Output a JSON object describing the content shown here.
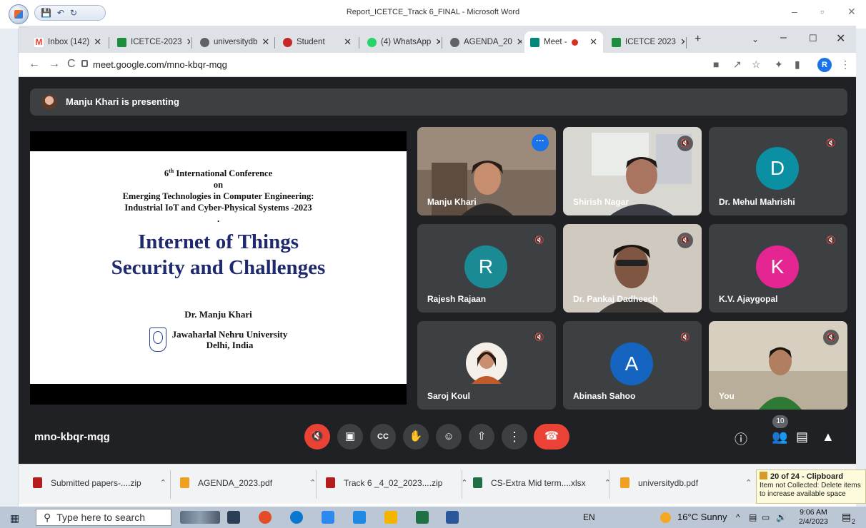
{
  "word": {
    "title": "Report_ICETCE_Track 6_FINAL - Microsoft Word",
    "controls": [
      "–",
      "▫",
      "✕"
    ]
  },
  "browser": {
    "tabs": [
      {
        "label": "Inbox (142)",
        "icon": "gmail-icon",
        "color": "#ea4335"
      },
      {
        "label": "ICETCE-2023",
        "icon": "drive-icon",
        "color": "#1e8e3e"
      },
      {
        "label": "universitydb",
        "icon": "chrome-icon",
        "color": "#5f6368"
      },
      {
        "label": "Student",
        "icon": "university-icon",
        "color": "#c62828"
      },
      {
        "label": "(4) WhatsApp",
        "icon": "whatsapp-icon",
        "color": "#25d366"
      },
      {
        "label": "AGENDA_20",
        "icon": "chrome-icon",
        "color": "#5f6368"
      },
      {
        "label": "Meet -",
        "icon": "meet-icon",
        "color": "#00897b"
      },
      {
        "label": "ICETCE 2023",
        "icon": "drive-icon",
        "color": "#1e8e3e"
      }
    ],
    "active_tab": 6,
    "new_tab": "+",
    "url": "meet.google.com/mno-kbqr-mqg",
    "profile_initial": "R"
  },
  "meet": {
    "presenting": "Manju Khari is presenting",
    "meeting_code": "mno-kbqr-mqg",
    "participant_count": "10",
    "slide": {
      "conf_line1_pre": "6",
      "conf_line1_sup": "th",
      "conf_line1_post": " International Conference",
      "conf_line2": "on",
      "conf_line3": "Emerging Technologies in Computer Engineering:",
      "conf_line4": "Industrial IoT and Cyber-Physical Systems -2023",
      "dot": ".",
      "title_line1": "Internet of Things",
      "title_line2": "Security and Challenges",
      "author": "Dr. Manju Khari",
      "uni_line1": "Jawaharlal Nehru University",
      "uni_line2": "Delhi, India",
      "logo_text": "JNU"
    },
    "participants": [
      {
        "name": "Manju Khari",
        "type": "video",
        "speaking": true
      },
      {
        "name": "Shirish Nagar",
        "type": "video"
      },
      {
        "name": "Dr. Mehul Mahrishi",
        "type": "letter",
        "letter": "D",
        "color": "#0b8fa3"
      },
      {
        "name": "Rajesh Rajaan",
        "type": "letter",
        "letter": "R",
        "color": "#1a8a95"
      },
      {
        "name": "Dr. Pankaj Dadheech",
        "type": "video"
      },
      {
        "name": "K.V. Ajaygopal",
        "type": "letter",
        "letter": "K",
        "color": "#e52592"
      },
      {
        "name": "Saroj Koul",
        "type": "photo"
      },
      {
        "name": "Abinash Sahoo",
        "type": "letter",
        "letter": "A",
        "color": "#1565c0"
      },
      {
        "name": "You",
        "type": "video"
      }
    ]
  },
  "downloads": [
    {
      "name": "Submitted papers-....zip",
      "icon": "zip-icon",
      "color": "#b71c1c"
    },
    {
      "name": "AGENDA_2023.pdf",
      "icon": "pdf-icon",
      "color": "#f0a020"
    },
    {
      "name": "Track 6 _4_02_2023....zip",
      "icon": "zip-icon",
      "color": "#b71c1c"
    },
    {
      "name": "CS-Extra Mid term....xlsx",
      "icon": "xlsx-icon",
      "color": "#1e7145"
    },
    {
      "name": "universitydb.pdf",
      "icon": "pdf-icon",
      "color": "#f0a020"
    }
  ],
  "clipboard": {
    "title": "20 of 24 - Clipboard",
    "line1": "Item not Collected: Delete items",
    "line2": "to increase available space"
  },
  "taskbar": {
    "search_placeholder": "Type here to search",
    "language": "EN",
    "weather": "16°C  Sunny",
    "time": "9:06 AM",
    "date": "2/4/2023",
    "notifications": "2"
  }
}
